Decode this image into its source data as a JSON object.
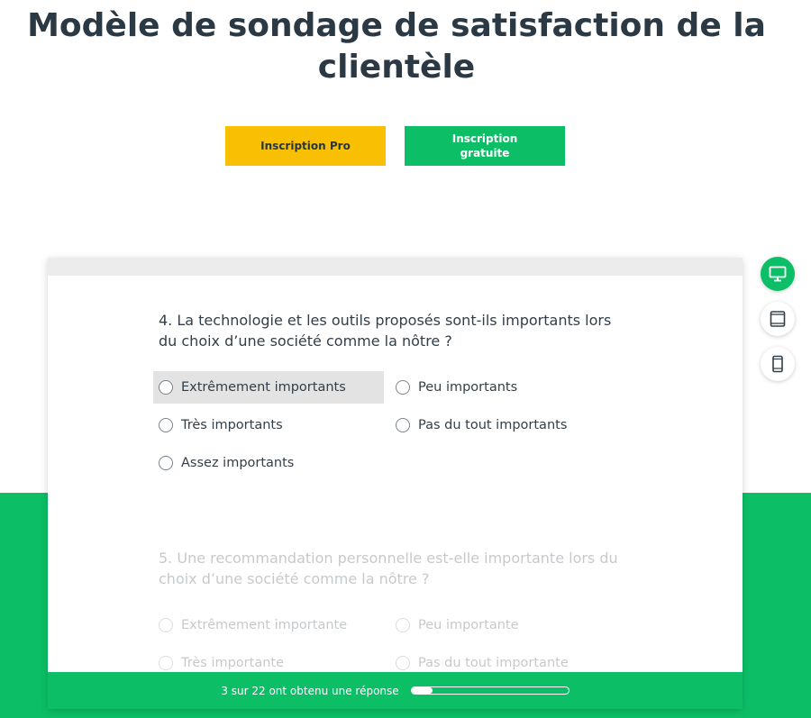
{
  "page": {
    "title": "Modèle de sondage de satisfaction de la clientèle"
  },
  "cta": {
    "pro_label": "Inscription Pro",
    "free_label": "Inscription gratuite"
  },
  "device_toggle": {
    "items": [
      {
        "icon": "desktop-icon",
        "active": true
      },
      {
        "icon": "tablet-icon",
        "active": false
      },
      {
        "icon": "mobile-icon",
        "active": false
      }
    ]
  },
  "survey": {
    "questions": [
      {
        "text": "4. La technologie et les outils proposés sont-ils importants lors du choix d’une société comme la nôtre ?",
        "options": [
          "Extrêmement importants",
          "Peu importants",
          "Très importants",
          "Pas du tout importants",
          "Assez importants"
        ]
      },
      {
        "text": "5. Une recommandation personnelle est-elle importante lors du choix d’une société comme la nôtre ?",
        "options": [
          "Extrêmement importante",
          "Peu importante",
          "Très importante",
          "Pas du tout importante"
        ]
      }
    ]
  },
  "progress": {
    "text": "3 sur 22 ont obtenu une réponse",
    "fraction": 0.136
  },
  "colors": {
    "accent_green": "#0cbf67",
    "accent_yellow": "#f8bf03",
    "title_text": "#2b3945"
  }
}
